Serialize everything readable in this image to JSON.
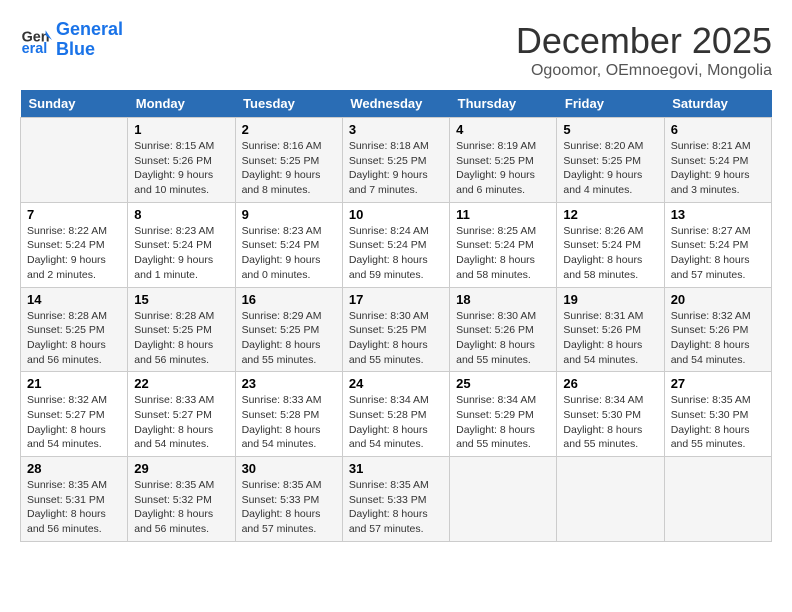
{
  "logo": {
    "line1": "General",
    "line2": "Blue"
  },
  "title": "December 2025",
  "location": "Ogoomor, OEmnoegovi, Mongolia",
  "days_header": [
    "Sunday",
    "Monday",
    "Tuesday",
    "Wednesday",
    "Thursday",
    "Friday",
    "Saturday"
  ],
  "weeks": [
    [
      {
        "day": "",
        "info": ""
      },
      {
        "day": "1",
        "info": "Sunrise: 8:15 AM\nSunset: 5:26 PM\nDaylight: 9 hours\nand 10 minutes."
      },
      {
        "day": "2",
        "info": "Sunrise: 8:16 AM\nSunset: 5:25 PM\nDaylight: 9 hours\nand 8 minutes."
      },
      {
        "day": "3",
        "info": "Sunrise: 8:18 AM\nSunset: 5:25 PM\nDaylight: 9 hours\nand 7 minutes."
      },
      {
        "day": "4",
        "info": "Sunrise: 8:19 AM\nSunset: 5:25 PM\nDaylight: 9 hours\nand 6 minutes."
      },
      {
        "day": "5",
        "info": "Sunrise: 8:20 AM\nSunset: 5:25 PM\nDaylight: 9 hours\nand 4 minutes."
      },
      {
        "day": "6",
        "info": "Sunrise: 8:21 AM\nSunset: 5:24 PM\nDaylight: 9 hours\nand 3 minutes."
      }
    ],
    [
      {
        "day": "7",
        "info": "Sunrise: 8:22 AM\nSunset: 5:24 PM\nDaylight: 9 hours\nand 2 minutes."
      },
      {
        "day": "8",
        "info": "Sunrise: 8:23 AM\nSunset: 5:24 PM\nDaylight: 9 hours\nand 1 minute."
      },
      {
        "day": "9",
        "info": "Sunrise: 8:23 AM\nSunset: 5:24 PM\nDaylight: 9 hours\nand 0 minutes."
      },
      {
        "day": "10",
        "info": "Sunrise: 8:24 AM\nSunset: 5:24 PM\nDaylight: 8 hours\nand 59 minutes."
      },
      {
        "day": "11",
        "info": "Sunrise: 8:25 AM\nSunset: 5:24 PM\nDaylight: 8 hours\nand 58 minutes."
      },
      {
        "day": "12",
        "info": "Sunrise: 8:26 AM\nSunset: 5:24 PM\nDaylight: 8 hours\nand 58 minutes."
      },
      {
        "day": "13",
        "info": "Sunrise: 8:27 AM\nSunset: 5:24 PM\nDaylight: 8 hours\nand 57 minutes."
      }
    ],
    [
      {
        "day": "14",
        "info": "Sunrise: 8:28 AM\nSunset: 5:25 PM\nDaylight: 8 hours\nand 56 minutes."
      },
      {
        "day": "15",
        "info": "Sunrise: 8:28 AM\nSunset: 5:25 PM\nDaylight: 8 hours\nand 56 minutes."
      },
      {
        "day": "16",
        "info": "Sunrise: 8:29 AM\nSunset: 5:25 PM\nDaylight: 8 hours\nand 55 minutes."
      },
      {
        "day": "17",
        "info": "Sunrise: 8:30 AM\nSunset: 5:25 PM\nDaylight: 8 hours\nand 55 minutes."
      },
      {
        "day": "18",
        "info": "Sunrise: 8:30 AM\nSunset: 5:26 PM\nDaylight: 8 hours\nand 55 minutes."
      },
      {
        "day": "19",
        "info": "Sunrise: 8:31 AM\nSunset: 5:26 PM\nDaylight: 8 hours\nand 54 minutes."
      },
      {
        "day": "20",
        "info": "Sunrise: 8:32 AM\nSunset: 5:26 PM\nDaylight: 8 hours\nand 54 minutes."
      }
    ],
    [
      {
        "day": "21",
        "info": "Sunrise: 8:32 AM\nSunset: 5:27 PM\nDaylight: 8 hours\nand 54 minutes."
      },
      {
        "day": "22",
        "info": "Sunrise: 8:33 AM\nSunset: 5:27 PM\nDaylight: 8 hours\nand 54 minutes."
      },
      {
        "day": "23",
        "info": "Sunrise: 8:33 AM\nSunset: 5:28 PM\nDaylight: 8 hours\nand 54 minutes."
      },
      {
        "day": "24",
        "info": "Sunrise: 8:34 AM\nSunset: 5:28 PM\nDaylight: 8 hours\nand 54 minutes."
      },
      {
        "day": "25",
        "info": "Sunrise: 8:34 AM\nSunset: 5:29 PM\nDaylight: 8 hours\nand 55 minutes."
      },
      {
        "day": "26",
        "info": "Sunrise: 8:34 AM\nSunset: 5:30 PM\nDaylight: 8 hours\nand 55 minutes."
      },
      {
        "day": "27",
        "info": "Sunrise: 8:35 AM\nSunset: 5:30 PM\nDaylight: 8 hours\nand 55 minutes."
      }
    ],
    [
      {
        "day": "28",
        "info": "Sunrise: 8:35 AM\nSunset: 5:31 PM\nDaylight: 8 hours\nand 56 minutes."
      },
      {
        "day": "29",
        "info": "Sunrise: 8:35 AM\nSunset: 5:32 PM\nDaylight: 8 hours\nand 56 minutes."
      },
      {
        "day": "30",
        "info": "Sunrise: 8:35 AM\nSunset: 5:33 PM\nDaylight: 8 hours\nand 57 minutes."
      },
      {
        "day": "31",
        "info": "Sunrise: 8:35 AM\nSunset: 5:33 PM\nDaylight: 8 hours\nand 57 minutes."
      },
      {
        "day": "",
        "info": ""
      },
      {
        "day": "",
        "info": ""
      },
      {
        "day": "",
        "info": ""
      }
    ]
  ]
}
